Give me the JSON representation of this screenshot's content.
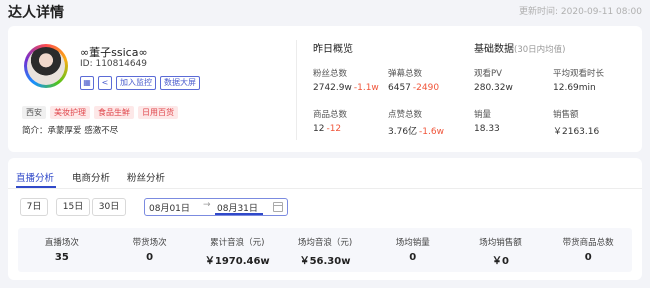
{
  "header": {
    "title": "达人详情",
    "update_label": "更新时间:",
    "update_time": "2020-09-11 08:00"
  },
  "profile": {
    "nickname": "∞董子ssica∞",
    "uid": "ID: 110814649",
    "actions": {
      "add_monitor": "加入监控",
      "data_screen": "数据大屏"
    },
    "tags": [
      "西安",
      "美妆护理",
      "食品生鲜",
      "日用百货"
    ],
    "intro": "简介：承蒙厚爱 感激不尽"
  },
  "yesterday": {
    "title": "昨日概览",
    "stats": [
      {
        "label": "粉丝总数",
        "value": "2742.9w",
        "delta": "-1.1w"
      },
      {
        "label": "弹幕总数",
        "value": "6457",
        "delta": "-2490"
      },
      {
        "label": "商品总数",
        "value": "12",
        "delta": "-12"
      },
      {
        "label": "点赞总数",
        "value": "3.76亿",
        "delta": "-1.6w"
      }
    ]
  },
  "basic": {
    "title": "基础数据",
    "subtitle": "(30日内均值)",
    "stats": [
      {
        "label": "观看PV",
        "value": "280.32w"
      },
      {
        "label": "平均观看时长",
        "value": "12.69min"
      },
      {
        "label": "销量",
        "value": "18.33"
      },
      {
        "label": "销售额",
        "value": "￥2163.16"
      }
    ]
  },
  "analysis": {
    "tabs": [
      "直播分析",
      "电商分析",
      "粉丝分析"
    ],
    "ranges": [
      "7日",
      "15日",
      "30日"
    ],
    "date_start": "08月01日",
    "date_arrow": "→",
    "date_end": "08月31日",
    "metrics": [
      {
        "label": "直播场次",
        "value": "35"
      },
      {
        "label": "带货场次",
        "value": "0"
      },
      {
        "label": "累计音浪（元)",
        "value": "￥1970.46w"
      },
      {
        "label": "场均音浪（元)",
        "value": "￥56.30w"
      },
      {
        "label": "场均销量",
        "value": "0"
      },
      {
        "label": "场均销售额",
        "value": "￥0"
      },
      {
        "label": "带货商品总数",
        "value": "0"
      }
    ]
  }
}
